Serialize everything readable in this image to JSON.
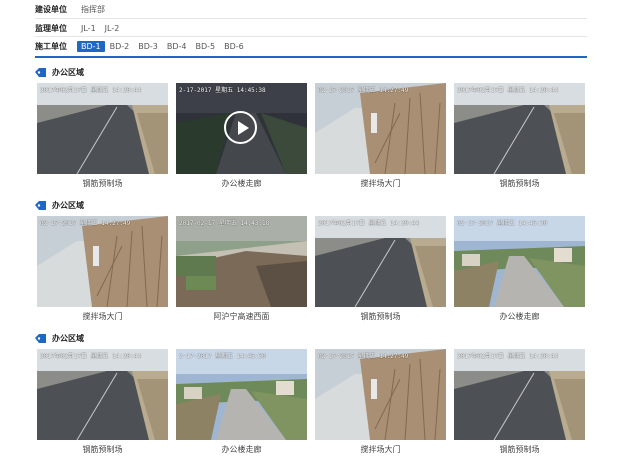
{
  "filters": {
    "rows": [
      {
        "label": "建设单位",
        "options": [
          "指挥部"
        ],
        "selected": -1
      },
      {
        "label": "监理单位",
        "options": [
          "JL-1",
          "JL-2"
        ],
        "selected": -1
      },
      {
        "label": "施工单位",
        "options": [
          "BD-1",
          "BD-2",
          "BD-3",
          "BD-4",
          "BD-5",
          "BD-6"
        ],
        "selected": 0
      }
    ]
  },
  "accent": "#1c68c4",
  "sections": [
    {
      "title": "办公区域",
      "tiles": [
        {
          "caption": "钢筋预制场",
          "stamp": "2017年02月17日 星期五 14:20:44",
          "scene": "road",
          "play": false
        },
        {
          "caption": "办公楼走廊",
          "stamp": "2-17-2017 星期五 14:45:38",
          "scene": "dark",
          "play": true
        },
        {
          "caption": "搅拌场大门",
          "stamp": "02-17-2017 星期五 14:27:49",
          "scene": "bush",
          "play": false
        },
        {
          "caption": "钢筋预制场",
          "stamp": "2017年02月17日 星期五 14:20:44",
          "scene": "road",
          "play": false
        }
      ]
    },
    {
      "title": "办公区域",
      "tiles": [
        {
          "caption": "搅拌场大门",
          "stamp": "02-17-2017 星期五 14:27:49",
          "scene": "bush",
          "play": false
        },
        {
          "caption": "阿沪宁高速西面",
          "stamp": "2017-02-17 星期五 14:43:18",
          "scene": "dirt",
          "play": false
        },
        {
          "caption": "钢筋预制场",
          "stamp": "2017年02月17日 星期五 14:20:44",
          "scene": "road",
          "play": false
        },
        {
          "caption": "办公楼走廊",
          "stamp": "02-17-2017 星期五 14:45:30",
          "scene": "village",
          "play": false
        }
      ]
    },
    {
      "title": "办公区域",
      "tiles": [
        {
          "caption": "钢筋预制场",
          "stamp": "2017年02月17日 星期五 14:20:44",
          "scene": "road",
          "play": false
        },
        {
          "caption": "办公楼走廊",
          "stamp": "2-17-2017 星期五 14:45:30",
          "scene": "village",
          "play": false
        },
        {
          "caption": "搅拌场大门",
          "stamp": "02-17-2017 星期五 14:27:49",
          "scene": "bush",
          "play": false
        },
        {
          "caption": "钢筋预制场",
          "stamp": "2017年02月17日 星期五 14:20:44",
          "scene": "road",
          "play": false
        }
      ]
    }
  ]
}
